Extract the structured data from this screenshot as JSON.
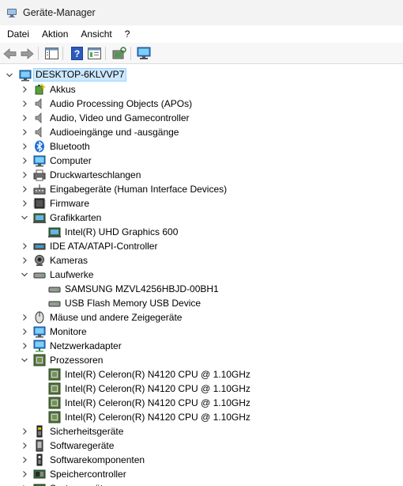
{
  "window": {
    "title": "Geräte-Manager"
  },
  "menu": [
    "Datei",
    "Aktion",
    "Ansicht",
    "?"
  ],
  "toolbar": [
    "back-icon",
    "forward-icon",
    "show-hide-tree-icon",
    "help-icon",
    "properties-icon",
    "scan-hardware-icon",
    "monitor-icon"
  ],
  "tree": {
    "root": "DESKTOP-6KLVVP7",
    "categories": [
      {
        "label": "Akkus",
        "icon": "battery-icon",
        "expanded": false
      },
      {
        "label": "Audio Processing Objects (APOs)",
        "icon": "speaker-icon",
        "expanded": false
      },
      {
        "label": "Audio, Video und Gamecontroller",
        "icon": "speaker-icon",
        "expanded": false
      },
      {
        "label": "Audioeingänge und -ausgänge",
        "icon": "speaker-icon",
        "expanded": false
      },
      {
        "label": "Bluetooth",
        "icon": "bluetooth-icon",
        "expanded": false
      },
      {
        "label": "Computer",
        "icon": "computer-icon",
        "expanded": false
      },
      {
        "label": "Druckwarteschlangen",
        "icon": "printer-icon",
        "expanded": false
      },
      {
        "label": "Eingabegeräte (Human Interface Devices)",
        "icon": "hid-icon",
        "expanded": false
      },
      {
        "label": "Firmware",
        "icon": "firmware-icon",
        "expanded": false
      },
      {
        "label": "Grafikkarten",
        "icon": "display-adapter-icon",
        "expanded": true,
        "children": [
          "Intel(R) UHD Graphics 600"
        ]
      },
      {
        "label": "IDE ATA/ATAPI-Controller",
        "icon": "ide-icon",
        "expanded": false
      },
      {
        "label": "Kameras",
        "icon": "camera-icon",
        "expanded": false
      },
      {
        "label": "Laufwerke",
        "icon": "drive-icon",
        "expanded": true,
        "children": [
          "SAMSUNG MZVL4256HBJD-00BH1",
          "USB Flash Memory USB Device"
        ]
      },
      {
        "label": "Mäuse und andere Zeigegeräte",
        "icon": "mouse-icon",
        "expanded": false
      },
      {
        "label": "Monitore",
        "icon": "monitor-icon",
        "expanded": false
      },
      {
        "label": "Netzwerkadapter",
        "icon": "network-icon",
        "expanded": false
      },
      {
        "label": "Prozessoren",
        "icon": "processor-icon",
        "expanded": true,
        "children": [
          "Intel(R) Celeron(R) N4120 CPU @ 1.10GHz",
          "Intel(R) Celeron(R) N4120 CPU @ 1.10GHz",
          "Intel(R) Celeron(R) N4120 CPU @ 1.10GHz",
          "Intel(R) Celeron(R) N4120 CPU @ 1.10GHz"
        ]
      },
      {
        "label": "Sicherheitsgeräte",
        "icon": "security-icon",
        "expanded": false
      },
      {
        "label": "Softwaregeräte",
        "icon": "software-device-icon",
        "expanded": false
      },
      {
        "label": "Softwarekomponenten",
        "icon": "software-component-icon",
        "expanded": false
      },
      {
        "label": "Speichercontroller",
        "icon": "storage-controller-icon",
        "expanded": false
      },
      {
        "label": "Systemgeräte",
        "icon": "system-icon",
        "expanded": false
      }
    ]
  },
  "colors": {
    "selection": "#cce8ff",
    "selection_border": "#99d1ff",
    "toolbar_bg": "#f7f7f7",
    "titlebar_bg": "#f3f3f3"
  }
}
